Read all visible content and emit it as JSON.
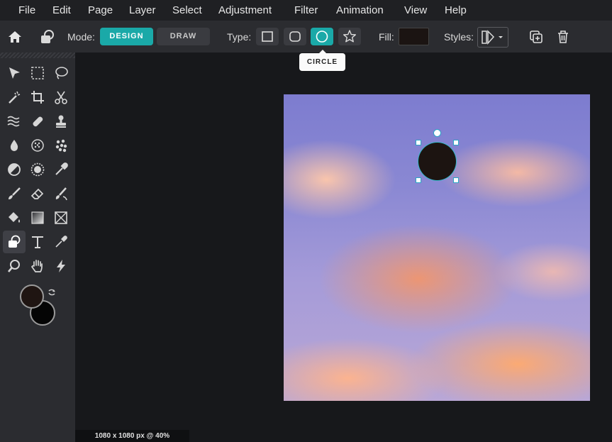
{
  "menu": {
    "items": [
      "File",
      "Edit",
      "Page",
      "Layer",
      "Select",
      "Adjustment",
      "Filter",
      "Animation",
      "View",
      "Help"
    ]
  },
  "toolbar": {
    "mode_label": "Mode:",
    "mode_design": "DESIGN",
    "mode_draw": "DRAW",
    "mode_selected": "DESIGN",
    "type_label": "Type:",
    "type_options": [
      "rectangle",
      "rounded-rectangle",
      "circle",
      "star"
    ],
    "type_selected": "circle",
    "fill_label": "Fill:",
    "fill_color": "#1b1412",
    "styles_label": "Styles:",
    "accent_color": "#1aa9a8"
  },
  "tooltip": {
    "text": "CIRCLE"
  },
  "tools": {
    "items": [
      "move",
      "marquee-select",
      "lasso",
      "magic-wand",
      "crop",
      "cut",
      "liquify",
      "heal",
      "clone-stamp",
      "blur",
      "sponge",
      "dodge-burn",
      "contrast",
      "color-adjust",
      "eyedropper-pen",
      "brush",
      "eraser",
      "smudge",
      "bucket-fill",
      "gradient",
      "placeholder",
      "shape",
      "text",
      "color-picker",
      "zoom",
      "hand",
      "auto-enhance"
    ],
    "active": "shape",
    "foreground_color": "#1f1512",
    "background_color": "#050505"
  },
  "canvas": {
    "shape_fill": "#1c1411"
  },
  "status": {
    "text": "1080 x 1080 px @ 40%"
  }
}
